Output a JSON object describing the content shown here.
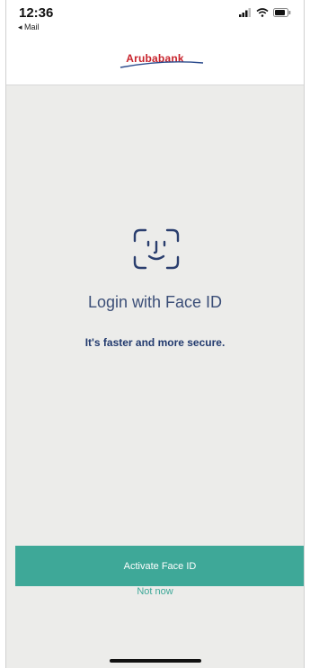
{
  "status_bar": {
    "time": "12:36",
    "back_app": "◂ Mail"
  },
  "header": {
    "logo": "Arubabank",
    "brand_color": "#c8232c"
  },
  "faceid": {
    "icon": "face-id-icon",
    "title": "Login with Face ID",
    "subtitle": "It's faster and more secure."
  },
  "actions": {
    "activate_label": "Activate Face ID",
    "not_now_label": "Not now",
    "accent_color": "#3ea898"
  }
}
